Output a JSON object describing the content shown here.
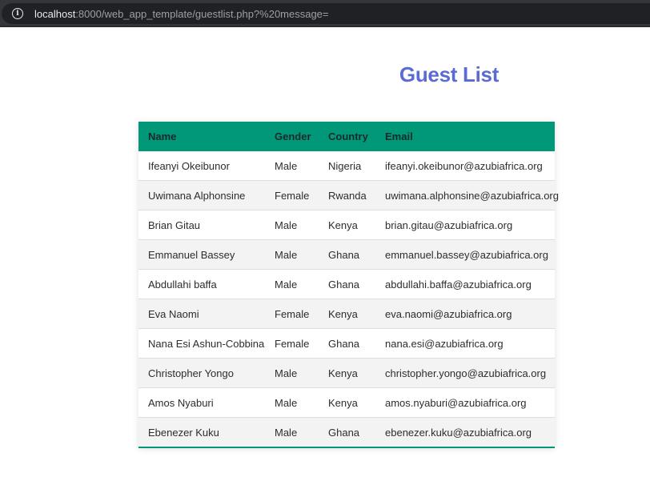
{
  "browser": {
    "url_host": "localhost",
    "url_rest": ":8000/web_app_template/guestlist.php?%20message="
  },
  "page": {
    "title": "Guest List"
  },
  "colors": {
    "title": "#5a6bd4",
    "header_bg": "#009879",
    "stripe": "#f3f3f3"
  },
  "table": {
    "headers": [
      "Name",
      "Gender",
      "Country",
      "Email"
    ],
    "rows": [
      [
        "Ifeanyi Okeibunor",
        "Male",
        "Nigeria",
        "ifeanyi.okeibunor@azubiafrica.org"
      ],
      [
        "Uwimana Alphonsine",
        "Female",
        "Rwanda",
        "uwimana.alphonsine@azubiafrica.org"
      ],
      [
        "Brian Gitau",
        "Male",
        "Kenya",
        "brian.gitau@azubiafrica.org"
      ],
      [
        "Emmanuel Bassey",
        "Male",
        "Ghana",
        "emmanuel.bassey@azubiafrica.org"
      ],
      [
        "Abdullahi baffa",
        "Male",
        "Ghana",
        "abdullahi.baffa@azubiafrica.org"
      ],
      [
        "Eva Naomi",
        "Female",
        "Kenya",
        "eva.naomi@azubiafrica.org"
      ],
      [
        "Nana Esi Ashun-Cobbina",
        "Female",
        "Ghana",
        "nana.esi@azubiafrica.org"
      ],
      [
        "Christopher Yongo",
        "Male",
        "Kenya",
        "christopher.yongo@azubiafrica.org"
      ],
      [
        "Amos Nyaburi",
        "Male",
        "Kenya",
        "amos.nyaburi@azubiafrica.org"
      ],
      [
        "Ebenezer Kuku",
        "Male",
        "Ghana",
        "ebenezer.kuku@azubiafrica.org"
      ]
    ]
  }
}
